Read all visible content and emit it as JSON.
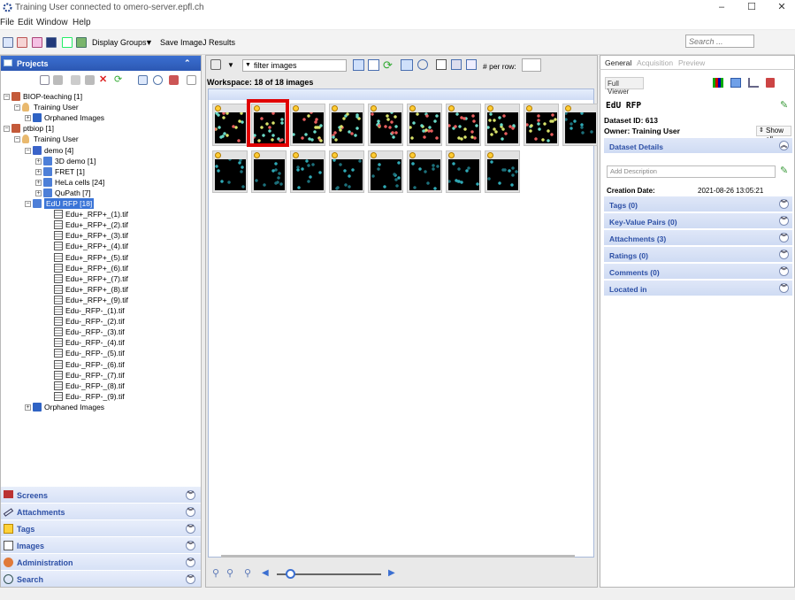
{
  "window": {
    "title": "Training User connected to omero-server.epfl.ch"
  },
  "menu": [
    "File",
    "Edit",
    "Window",
    "Help"
  ],
  "toolbar": {
    "display_groups": "Display Groups",
    "save_results": "Save ImageJ Results",
    "search_placeholder": "Search ..."
  },
  "left": {
    "header": "Projects",
    "tree": [
      {
        "label": "BIOP-teaching [1]"
      },
      {
        "label": "Training User"
      },
      {
        "label": "Orphaned Images"
      },
      {
        "label": "ptbiop [1]"
      },
      {
        "label": "Training User"
      },
      {
        "label": "demo [4]"
      },
      {
        "label": "3D demo [1]"
      },
      {
        "label": "FRET [1]"
      },
      {
        "label": "HeLa cells [24]"
      },
      {
        "label": "QuPath [7]"
      },
      {
        "label": "EdU RFP [18]"
      },
      {
        "label": "Edu+_RFP+_(1).tif"
      },
      {
        "label": "Edu+_RFP+_(2).tif"
      },
      {
        "label": "Edu+_RFP+_(3).tif"
      },
      {
        "label": "Edu+_RFP+_(4).tif"
      },
      {
        "label": "Edu+_RFP+_(5).tif"
      },
      {
        "label": "Edu+_RFP+_(6).tif"
      },
      {
        "label": "Edu+_RFP+_(7).tif"
      },
      {
        "label": "Edu+_RFP+_(8).tif"
      },
      {
        "label": "Edu+_RFP+_(9).tif"
      },
      {
        "label": "Edu-_RFP-_(1).tif"
      },
      {
        "label": "Edu-_RFP-_(2).tif"
      },
      {
        "label": "Edu-_RFP-_(3).tif"
      },
      {
        "label": "Edu-_RFP-_(4).tif"
      },
      {
        "label": "Edu-_RFP-_(5).tif"
      },
      {
        "label": "Edu-_RFP-_(6).tif"
      },
      {
        "label": "Edu-_RFP-_(7).tif"
      },
      {
        "label": "Edu-_RFP-_(8).tif"
      },
      {
        "label": "Edu-_RFP-_(9).tif"
      },
      {
        "label": "Orphaned Images"
      }
    ],
    "sections": [
      "Screens",
      "Attachments",
      "Tags",
      "Images",
      "Administration",
      "Search"
    ]
  },
  "center": {
    "filter": "filter  images",
    "per_row_label": "# per row:",
    "workspace": "Workspace: 18 of 18 images"
  },
  "right": {
    "tabs": [
      "General",
      "Acquisition",
      "Preview"
    ],
    "full_viewer": "Full Viewer",
    "dataset_name": "EdU RFP",
    "dataset_id": "Dataset ID: 613",
    "owner": "Owner: Training User",
    "show_all": "Show all",
    "dataset_details": "Dataset Details",
    "desc_placeholder": "Add Description",
    "creation_label": "Creation Date:",
    "creation_value": "2021-08-26 13:05:21",
    "sections": [
      "Tags (0)",
      "Key-Value Pairs (0)",
      "Attachments (3)",
      "Ratings (0)",
      "Comments (0)",
      "Located in"
    ]
  },
  "colors": {
    "accent": "#3a74d7",
    "highlight": "#e00000",
    "section_text": "#2d50a6"
  }
}
